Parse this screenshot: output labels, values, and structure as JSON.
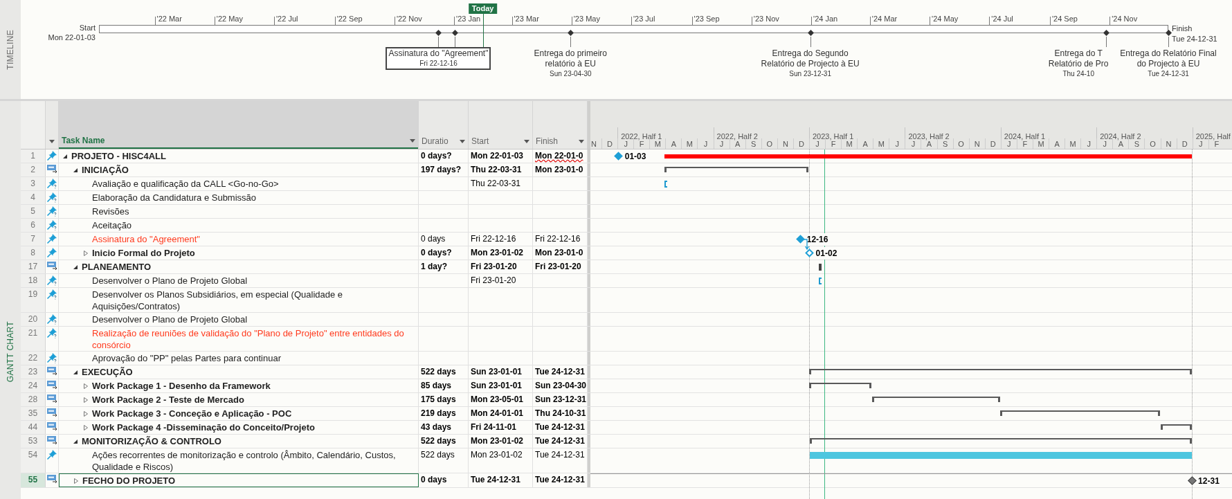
{
  "timeline": {
    "label": "TIMELINE",
    "today_label": "Today",
    "level": 0.359,
    "start": {
      "label": "Start",
      "date_text": "Mon 22-01-03"
    },
    "finish": {
      "label": "Finish",
      "date_text": "Tue 24-12-31"
    },
    "ticks": [
      "'22 Mar",
      "'22 May",
      "'22 Jul",
      "'22 Sep",
      "'22 Nov",
      "'23 Jan",
      "'23 Mar",
      "'23 May",
      "'23 Jul",
      "'23 Sep",
      "'23 Nov",
      "'24 Jan",
      "'24 Mar",
      "'24 May",
      "'24 Jul",
      "'24 Sep",
      "'24 Nov"
    ],
    "milestones": [
      {
        "kind": "centered",
        "lines": [
          "Assinatura do \"Agreement\""
        ],
        "date_text": "Fri 22-12-16",
        "selected": true
      },
      {
        "kind": "plain",
        "level": 0.333,
        "selected": false
      },
      {
        "kind": "centered",
        "lines": [
          "Entrega do primeiro",
          "relatório à EU"
        ],
        "date_text": "Sun 23-04-30",
        "selected": false
      },
      {
        "kind": "centered",
        "lines": [
          "Entrega do Segundo",
          "Relatório de Projecto à EU"
        ],
        "date_text": "Sun 23-12-31",
        "selected": false
      },
      {
        "kind": "clipped",
        "lines": [
          "Entrega do T",
          "Relatório de Pro"
        ],
        "date_text": "Thu 24-10",
        "selected": false
      },
      {
        "kind": "centered",
        "lines": [
          "Entrega do Relatório Final",
          "do Projecto à EU"
        ],
        "date_text": "Tue 24-12-31",
        "selected": false
      }
    ]
  },
  "gantt": {
    "label": "GANTT CHART",
    "columns": [
      "Task Name",
      "Duratio",
      "Start",
      "Finish"
    ],
    "timescale": {
      "halves": [
        "2022, Half 1",
        "2022, Half 2",
        "2023, Half 1",
        "2023, Half 2",
        "2024, Half 1",
        "2024, Half 2",
        "2025, Half"
      ],
      "months": [
        "N",
        "D",
        "J",
        "F",
        "M",
        "A",
        "M",
        "J",
        "J",
        "A",
        "S",
        "O",
        "N",
        "D",
        "J",
        "F",
        "M",
        "A",
        "M",
        "J",
        "J",
        "A",
        "S",
        "O",
        "N",
        "D",
        "J",
        "F",
        "M",
        "A",
        "M",
        "J",
        "J",
        "A",
        "S",
        "O",
        "N",
        "D",
        "J",
        "F"
      ]
    },
    "rows": [
      {
        "id": "1",
        "kind": "manual",
        "name": "PROJETO - HISC4ALL",
        "duration": "0 days?",
        "start": "Mon 22-01-03",
        "finish": "Mon 22-01-0",
        "finish_flagged": true,
        "selected": false,
        "expanded": true,
        "bars": [
          {
            "kind": "milestone",
            "label": "01-03"
          },
          {
            "kind": "critical"
          }
        ],
        "children": [
          {
            "id": "2",
            "kind": "auto",
            "name": "INICIAÇÃO",
            "duration": "197 days?",
            "start": "Thu 22-03-31",
            "finish": "Mon 23-01-0",
            "selected": false,
            "expanded": true,
            "bars": [
              {
                "kind": "summary",
                "bounds": false
              }
            ],
            "children": [
              {
                "id": "3",
                "kind": "manual_unknown",
                "name": "Avaliação e qualificação da CALL <Go-no-Go>",
                "start": "Thu 22-03-31",
                "selected": false,
                "bars": [
                  {
                    "kind": "start_marker"
                  }
                ]
              },
              {
                "id": "4",
                "kind": "manual_unknown",
                "name": "Elaboração da Candidatura e Submissão",
                "selected": false
              },
              {
                "id": "5",
                "kind": "manual_unknown",
                "name": "Revisões",
                "selected": false
              },
              {
                "id": "6",
                "kind": "manual_unknown",
                "name": "Aceitação",
                "selected": false
              },
              {
                "id": "7",
                "kind": "manual",
                "name": "Assinatura do \"Agreement\"",
                "color": "#ff3a1e",
                "duration": "0 days",
                "start": "Fri 22-12-16",
                "finish": "Fri 22-12-16",
                "selected": false,
                "bars": [
                  {
                    "kind": "milestone",
                    "label": "12-16"
                  },
                  {
                    "kind": "link"
                  }
                ]
              },
              {
                "id": "8",
                "kind": "manual",
                "name": "Inicio Formal do Projeto",
                "duration": "0 days?",
                "start": "Mon 23-01-02",
                "finish": "Mon 23-01-0",
                "selected": false,
                "expanded": false,
                "bars": [
                  {
                    "kind": "milestone_hollow",
                    "label": "01-02"
                  }
                ]
              }
            ]
          },
          {
            "id": "17",
            "kind": "auto",
            "name": "PLANEAMENTO",
            "duration": "1 day?",
            "start": "Fri 23-01-20",
            "finish": "Fri 23-01-20",
            "selected": false,
            "expanded": true,
            "bars": [
              {
                "kind": "tick"
              }
            ],
            "children": [
              {
                "id": "18",
                "kind": "manual_unknown",
                "name": "Desenvolver o Plano de Projeto Global",
                "start": "Fri 23-01-20",
                "selected": false,
                "bars": [
                  {
                    "kind": "start_marker"
                  }
                ]
              },
              {
                "id": "19",
                "kind": "manual_unknown",
                "name": "Desenvolver os Planos Subsidiários, em especial (Qualidade e Aquisições/Contratos)",
                "selected": false
              },
              {
                "id": "20",
                "kind": "manual_unknown",
                "name": "Desenvolver o Plano de Projeto Global",
                "selected": false
              },
              {
                "id": "21",
                "kind": "manual_unknown",
                "name": "Realização de reuniões de validação do \"Plano de Projeto\" entre entidades do consórcio",
                "color": "#ff3a1e",
                "selected": false
              },
              {
                "id": "22",
                "kind": "manual_unknown",
                "name": "Aprovação do \"PP\" pelas Partes para continuar",
                "selected": false
              }
            ]
          },
          {
            "id": "23",
            "kind": "auto",
            "name": "EXECUÇÃO",
            "duration": "522 days",
            "start": "Sun 23-01-01",
            "finish": "Tue 24-12-31",
            "selected": false,
            "expanded": true,
            "bars": [
              {
                "kind": "summary",
                "bounds": true
              }
            ],
            "children": [
              {
                "id": "24",
                "kind": "auto",
                "name": "Work Package 1 - Desenho da Framework",
                "duration": "85 days",
                "start": "Sun 23-01-01",
                "finish": "Sun 23-04-30",
                "selected": false,
                "expanded": false,
                "bars": [
                  {
                    "kind": "summary",
                    "bounds": false
                  }
                ]
              },
              {
                "id": "28",
                "kind": "auto",
                "name": "Work Package 2 - Teste de Mercado",
                "duration": "175 days",
                "start": "Mon 23-05-01",
                "finish": "Sun 23-12-31",
                "selected": false,
                "expanded": false,
                "bars": [
                  {
                    "kind": "summary",
                    "bounds": false
                  }
                ]
              },
              {
                "id": "35",
                "kind": "auto",
                "name": "Work Package 3 - Conceção e Aplicação - POC",
                "duration": "219 days",
                "start": "Mon 24-01-01",
                "finish": "Thu 24-10-31",
                "selected": false,
                "expanded": false,
                "bars": [
                  {
                    "kind": "summary",
                    "bounds": false
                  }
                ]
              },
              {
                "id": "44",
                "kind": "auto",
                "name": "Work Package 4 -Disseminação do Conceito/Projeto",
                "duration": "43 days",
                "start": "Fri 24-11-01",
                "finish": "Tue 24-12-31",
                "selected": false,
                "expanded": false,
                "bars": [
                  {
                    "kind": "summary",
                    "bounds": false
                  }
                ]
              }
            ]
          },
          {
            "id": "53",
            "kind": "auto",
            "name": "MONITORIZAÇÃO & CONTROLO",
            "duration": "522 days",
            "start": "Mon 23-01-02",
            "finish": "Tue 24-12-31",
            "selected": false,
            "expanded": true,
            "bars": [
              {
                "kind": "summary",
                "bounds": false
              }
            ],
            "children": [
              {
                "id": "54",
                "kind": "manual",
                "name": "Ações recorrentes de monitorização e controlo (Âmbito, Calendário, Custos, Qualidade e Riscos)",
                "duration": "522 days",
                "start": "Mon 23-01-02",
                "finish": "Tue 24-12-31",
                "selected": false,
                "bars": [
                  {
                    "kind": "task"
                  }
                ]
              }
            ]
          },
          {
            "id": "55",
            "kind": "auto",
            "name": "FECHO DO PROJETO",
            "duration": "0 days",
            "start": "Tue 24-12-31",
            "finish": "Tue 24-12-31",
            "selected": true,
            "expanded": false,
            "bars": [
              {
                "kind": "milestone_gray",
                "label": "12-31"
              }
            ]
          }
        ]
      }
    ]
  }
}
